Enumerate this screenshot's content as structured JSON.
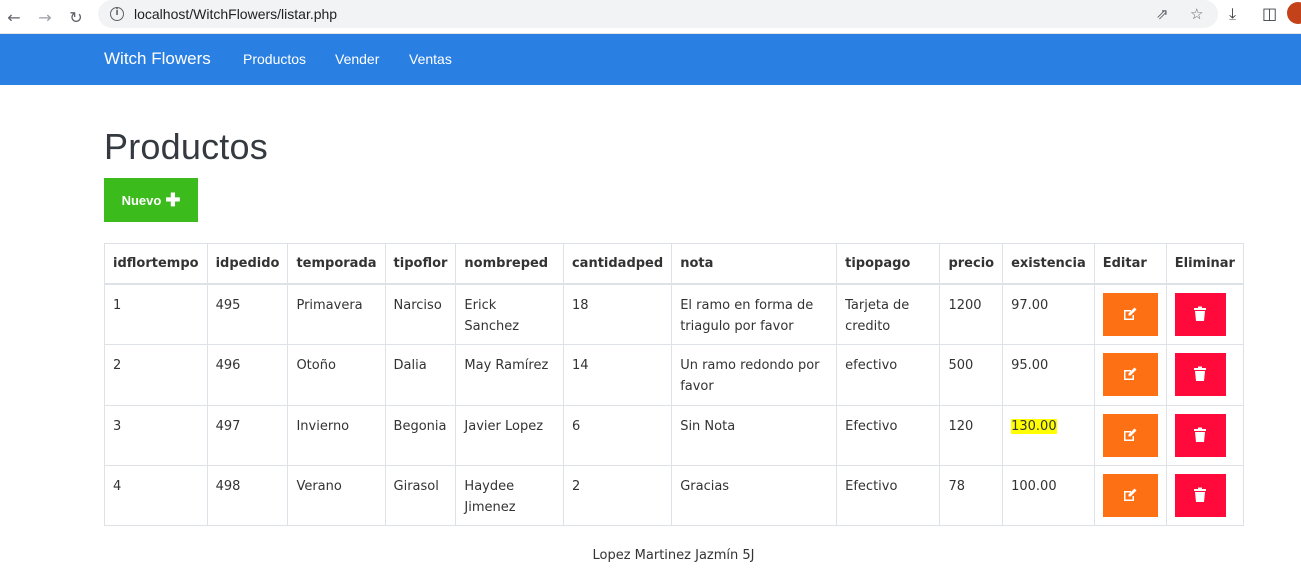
{
  "browser": {
    "url": "localhost/WitchFlowers/listar.php",
    "icons": [
      "back-arrow-icon",
      "forward-arrow-icon",
      "reload-icon",
      "info-icon",
      "share-icon",
      "star-icon",
      "download-icon",
      "sidepanel-icon"
    ]
  },
  "navbar": {
    "brand": "Witch Flowers",
    "links": [
      "Productos",
      "Vender",
      "Ventas"
    ],
    "color": "#2a7fe2"
  },
  "page": {
    "title": "Productos",
    "new_button_label": "Nuevo"
  },
  "table": {
    "headers": [
      "idflortempo",
      "idpedido",
      "temporada",
      "tipoflor",
      "nombreped",
      "cantidadped",
      "nota",
      "tipopago",
      "precio",
      "existencia",
      "Editar",
      "Eliminar"
    ],
    "rows": [
      [
        "1",
        "495",
        "Primavera",
        "Narciso",
        "Erick Sanchez",
        "18",
        "El ramo en forma de triagulo por favor",
        "Tarjeta de credito",
        "1200",
        "97.00"
      ],
      [
        "2",
        "496",
        "Otoño",
        "Dalia",
        "May Ramírez",
        "14",
        "Un ramo redondo por favor",
        "efectivo",
        "500",
        "95.00"
      ],
      [
        "3",
        "497",
        "Invierno",
        "Begonia",
        "Javier Lopez",
        "6",
        "Sin Nota",
        "Efectivo",
        "120",
        "130.00"
      ],
      [
        "4",
        "498",
        "Verano",
        "Girasol",
        "Haydee Jimenez",
        "2",
        "Gracias",
        "Efectivo",
        "78",
        "100.00"
      ]
    ]
  },
  "colors": {
    "edit": "#fd7014",
    "delete": "#ff0a3b",
    "new": "#3cbb1c",
    "highlight": "#ffff00"
  },
  "footer": {
    "text": "Lopez Martinez Jazmín 5J"
  }
}
